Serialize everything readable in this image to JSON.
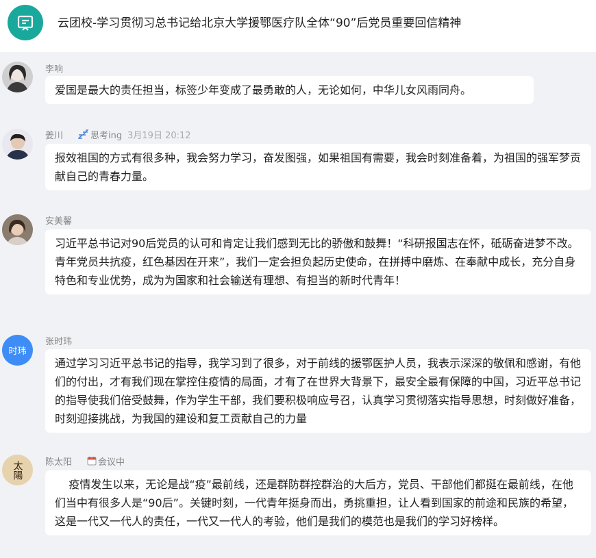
{
  "header": {
    "title": "云团校-学习贯彻习总书记给北京大学援鄂医疗队全体“90”后党员重要回信精神",
    "icon": "chat-board-icon",
    "accent_color": "#19a89c"
  },
  "messages": [
    {
      "name": "李响",
      "status": "",
      "time": "",
      "text": "爱国是最大的责任担当，标签少年变成了最勇敢的人，无论如何，中华儿女风雨同舟。"
    },
    {
      "name": "姜川",
      "status": "思考ing",
      "status_icon": "zzz-icon",
      "time": "3月19日 20:12",
      "text": "报效祖国的方式有很多种，我会努力学习，奋发图强，如果祖国有需要，我会时刻准备着，为祖国的强军梦贡献自己的青春力量。"
    },
    {
      "name": "安美馨",
      "status": "",
      "time": "",
      "text": "习近平总书记对90后党员的认可和肯定让我们感到无比的骄傲和鼓舞！“科研报国志在怀，砥砺奋进梦不改。青年党员共抗疫，红色基因在开来”，我们一定会担负起历史使命，在拼搏中磨炼、在奉献中成长，充分自身特色和专业优势，成为为国家和社会输送有理想、有担当的新时代青年！"
    },
    {
      "name": "张时玮",
      "avatar_text": "时玮",
      "status": "",
      "time": "",
      "text": "通过学习习近平总书记的指导，我学习到了很多，对于前线的援鄂医护人员，我表示深深的敬佩和感谢，有他们的付出，才有我们现在掌控住疫情的局面，才有了在世界大背景下，最安全最有保障的中国，习近平总书记的指导使我们倍受鼓舞，作为学生干部，我们要积极响应号召，认真学习贯彻落实指导思想，时刻做好准备，时刻迎接挑战，为我国的建设和复工贡献自己的力量"
    },
    {
      "name": "陈太阳",
      "avatar_text": "太陽",
      "status": "会议中",
      "status_icon": "calendar-icon",
      "time": "",
      "text": "    疫情发生以来，无论是战“疫”最前线，还是群防群控群治的大后方，党员、干部他们都挺在最前线，在他们当中有很多人是“90后”。关键时刻，一代青年挺身而出，勇挑重担，让人看到国家的前途和民族的希望，这是一代又一代人的责任，一代又一代人的考验，他们是我们的模范也是我们的学习好榜样。"
    }
  ]
}
